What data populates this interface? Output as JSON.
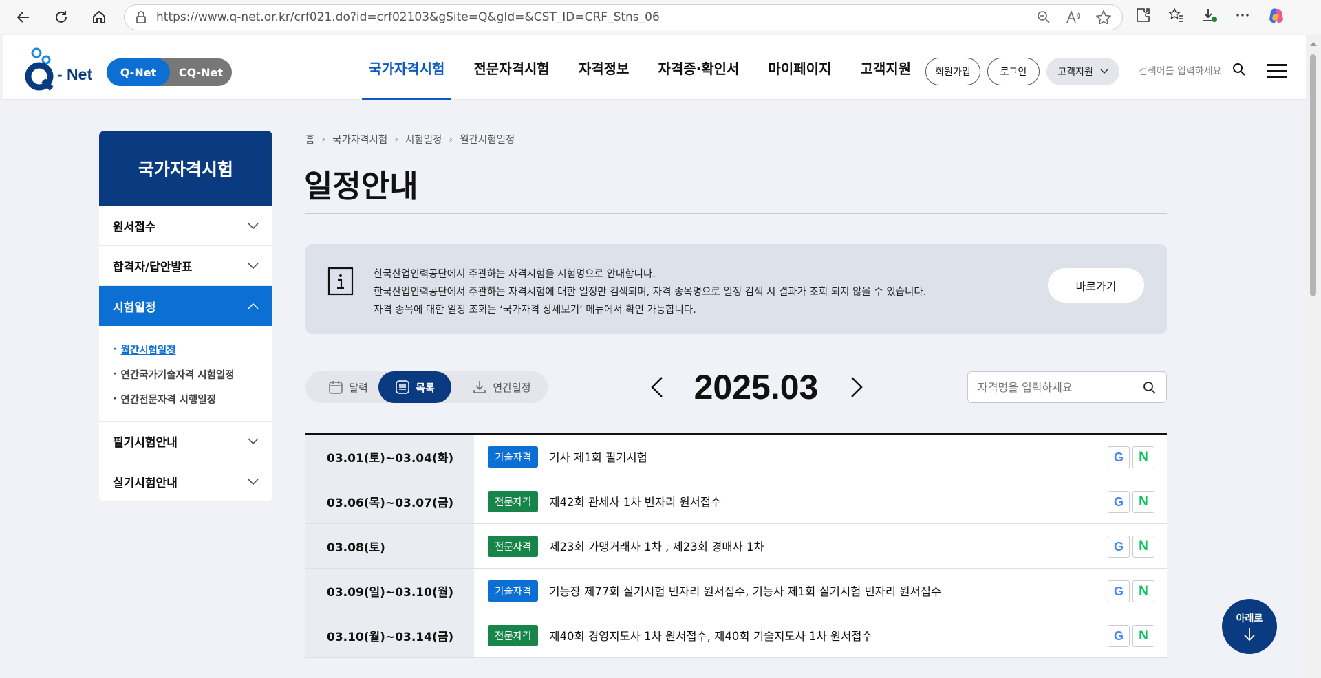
{
  "browser": {
    "url": "https://www.q-net.or.kr/crf021.do?id=crf02103&gSite=Q&gId=&CST_ID=CRF_Stns_06"
  },
  "header": {
    "logo_text": "- Net",
    "toggle_q": "Q-Net",
    "toggle_cq": "CQ-Net",
    "nav": [
      "국가자격시험",
      "전문자격시험",
      "자격정보",
      "자격증·확인서",
      "마이페이지",
      "고객지원"
    ],
    "signup": "회원가입",
    "login": "로그인",
    "support": "고객지원",
    "search_placeholder": "검색어를 입력하세요"
  },
  "sidebar": {
    "title": "국가자격시험",
    "items": [
      "원서접수",
      "합격자/답안발표",
      "시험일정",
      "필기시험안내",
      "실기시험안내"
    ],
    "sub_items": [
      "월간시험일정",
      "연간국가기술자격 시험일정",
      "연간전문자격 시행일정"
    ]
  },
  "breadcrumb": [
    "홈",
    "국가자격시험",
    "시험일정",
    "월간시험일정"
  ],
  "page_title": "일정안내",
  "notice": {
    "lines": [
      "한국산업인력공단에서 주관하는 자격시험을 시험명으로 안내합니다.",
      "한국산업인력공단에서 주관하는 자격시험에 대한 일정만 검색되며, 자격 종목명으로 일정 검색 시 결과가 조회 되지 않을 수 있습니다.",
      "자격 종목에 대한 일정 조회는 ‘국가자격 상세보기’ 메뉴에서 확인 가능합니다."
    ],
    "button": "바로가기"
  },
  "view_toggle": [
    "달력",
    "목록",
    "연간일정"
  ],
  "month_label": "2025.03",
  "search": {
    "placeholder": "자격명을 입력하세요"
  },
  "schedule": [
    {
      "date": "03.01(토)~03.04(화)",
      "badge": "기술자격",
      "type": "tech",
      "text": "기사 제1회 필기시험"
    },
    {
      "date": "03.06(목)~03.07(금)",
      "badge": "전문자격",
      "type": "pro",
      "text": "제42회 관세사 1차 빈자리 원서접수"
    },
    {
      "date": "03.08(토)",
      "badge": "전문자격",
      "type": "pro",
      "text": "제23회 가맹거래사 1차 , 제23회 경매사 1차"
    },
    {
      "date": "03.09(일)~03.10(월)",
      "badge": "기술자격",
      "type": "tech",
      "text": "기능장 제77회 실기시험 빈자리 원서접수, 기능사 제1회 실기시험 빈자리 원서접수"
    },
    {
      "date": "03.10(월)~03.14(금)",
      "badge": "전문자격",
      "type": "pro",
      "text": "제40회 경영지도사 1차 원서접수, 제40회 기술지도사 1차 원서접수"
    }
  ],
  "down_button": "아래로",
  "colors": {
    "navy": "#0a3b80",
    "blue": "#0c6fd4",
    "green": "#17854a"
  }
}
